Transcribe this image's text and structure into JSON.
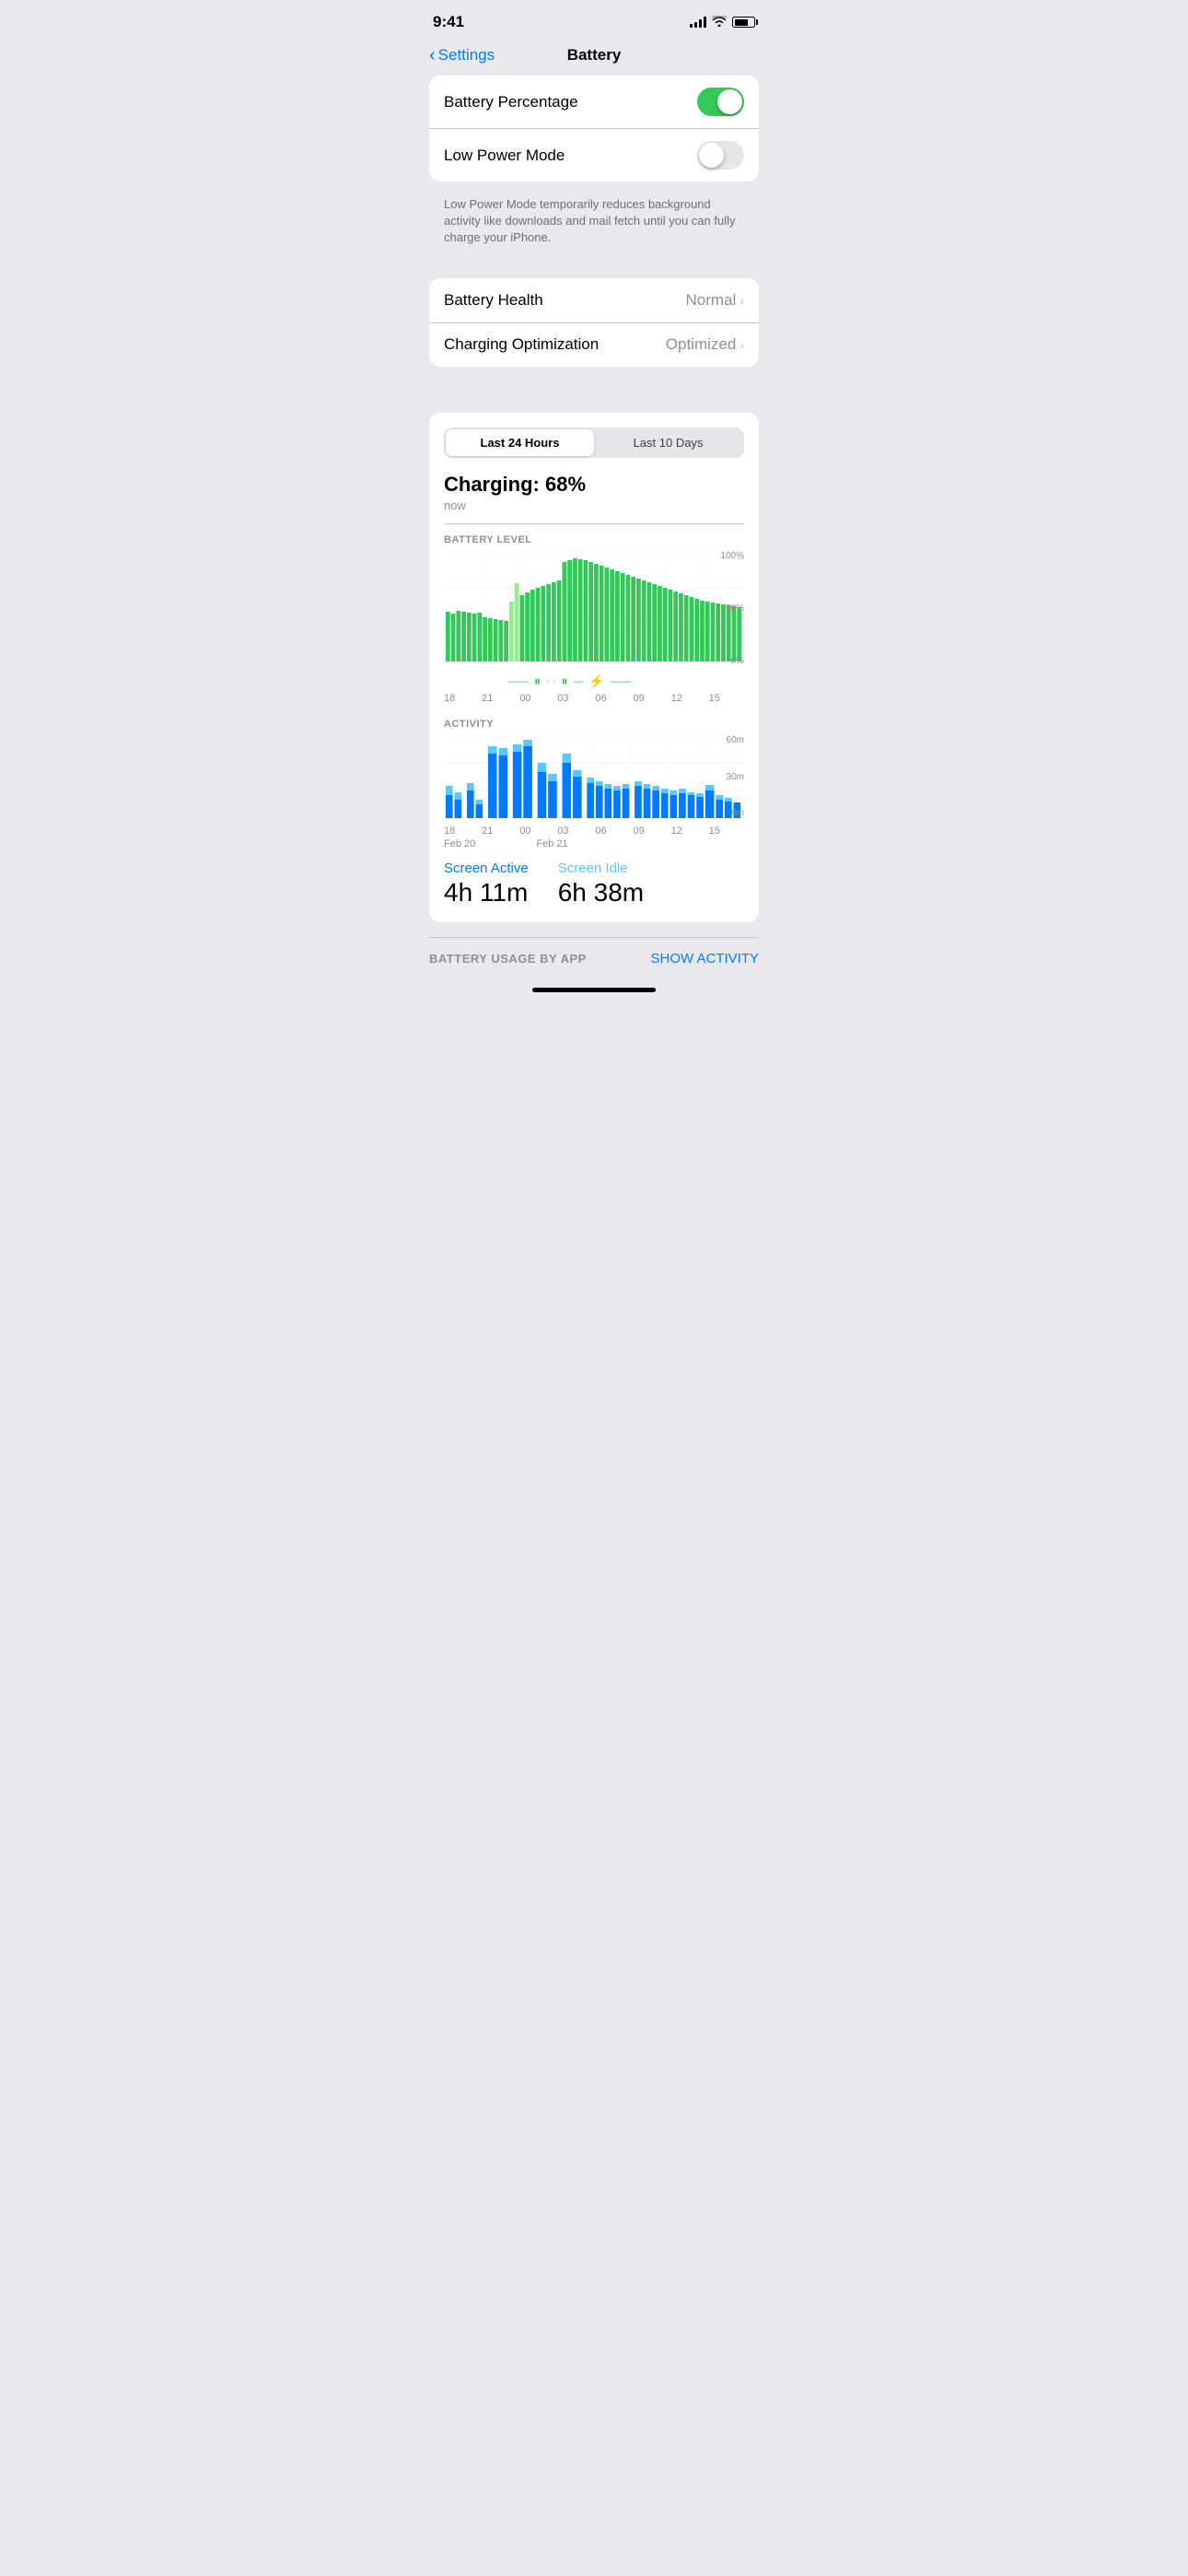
{
  "statusBar": {
    "time": "9:41",
    "battery": "70"
  },
  "nav": {
    "backLabel": "Settings",
    "title": "Battery"
  },
  "settings": {
    "batteryPercentageLabel": "Battery Percentage",
    "batteryPercentageOn": true,
    "lowPowerModeLabel": "Low Power Mode",
    "lowPowerModeOn": false,
    "lowPowerModeDescription": "Low Power Mode temporarily reduces background activity like downloads and mail fetch until you can fully charge your iPhone.",
    "batteryHealthLabel": "Battery Health",
    "batteryHealthValue": "Normal",
    "chargingOptimizationLabel": "Charging Optimization",
    "chargingOptimizationValue": "Optimized"
  },
  "batteryStats": {
    "tab1": "Last 24 Hours",
    "tab2": "Last 10 Days",
    "activeTab": "tab1",
    "chargingTitle": "Charging: 68%",
    "chargingSubtitle": "now",
    "batteryLevelLabel": "BATTERY LEVEL",
    "yAxis100": "100%",
    "yAxis50": "50%",
    "yAxis0": "0%",
    "xAxisLabels": [
      "18",
      "21",
      "00",
      "03",
      "06",
      "09",
      "12",
      "15"
    ],
    "activityLabel": "ACTIVITY",
    "activityY60": "60m",
    "activityY30": "30m",
    "activityY0": "0m",
    "xAxisBottomLabels": [
      "18",
      "21",
      "00",
      "03",
      "06",
      "09",
      "12",
      "15"
    ],
    "xAxisSubLabels": [
      "Feb 20",
      "",
      "Feb 21",
      "",
      "",
      "",
      "",
      ""
    ],
    "screenActiveLabel": "Screen Active",
    "screenActiveValue": "4h 11m",
    "screenIdleLabel": "Screen Idle",
    "screenIdleValue": "6h 38m"
  },
  "footer": {
    "batteryUsageByApp": "BATTERY USAGE BY APP",
    "showActivity": "SHOW ACTIVITY"
  },
  "icons": {
    "back": "‹",
    "chevronRight": "›"
  }
}
